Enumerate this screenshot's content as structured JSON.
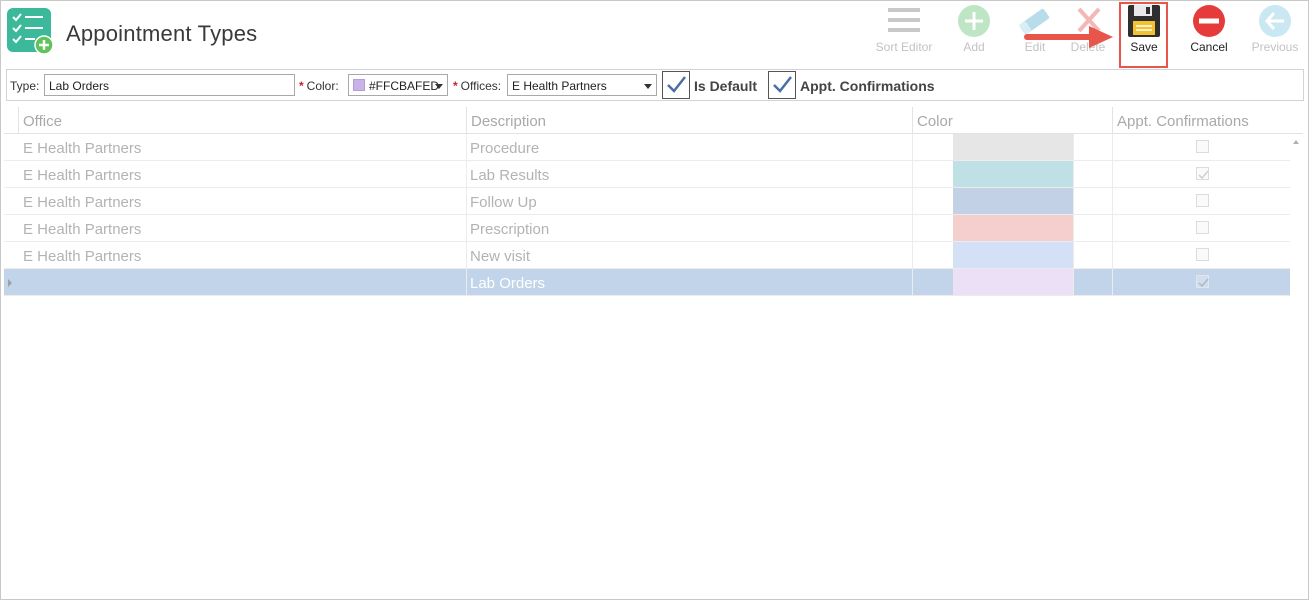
{
  "header": {
    "title": "Appointment Types"
  },
  "toolbar": {
    "sort_editor": "Sort Editor",
    "add": "Add",
    "edit": "Edit",
    "delete": "Delete",
    "save": "Save",
    "cancel": "Cancel",
    "previous": "Previous"
  },
  "form": {
    "type_label": "Type:",
    "type_value": "Lab Orders",
    "color_label": "Color:",
    "color_value": "#FFCBAFED",
    "offices_label": "Offices:",
    "offices_value": "E Health Partners",
    "is_default_label": "Is Default",
    "is_default_checked": true,
    "appt_confirmations_label": "Appt. Confirmations",
    "appt_confirmations_checked": true
  },
  "grid": {
    "columns": [
      "Office",
      "Description",
      "Color",
      "Appt. Confirmations"
    ],
    "rows": [
      {
        "office": "E Health Partners",
        "description": "Procedure",
        "color": "#e6e6e6",
        "confirm": false
      },
      {
        "office": "E Health Partners",
        "description": "Lab Results",
        "color": "#bfe1e6",
        "confirm": true
      },
      {
        "office": "E Health Partners",
        "description": "Follow Up",
        "color": "#c2d1e6",
        "confirm": false
      },
      {
        "office": "E Health Partners",
        "description": "Prescription",
        "color": "#f5cece",
        "confirm": false
      },
      {
        "office": "E Health Partners",
        "description": "New visit",
        "color": "#d3e0f5",
        "confirm": false
      },
      {
        "office": "",
        "description": "Lab Orders",
        "color": "#ebe0f5",
        "confirm": true,
        "selected": true
      }
    ]
  },
  "colors": {
    "accent_green": "#3cb89a",
    "cancel_red": "#e63b3b",
    "selection": "#c2d4ea",
    "highlight_box": "#e8554a"
  }
}
